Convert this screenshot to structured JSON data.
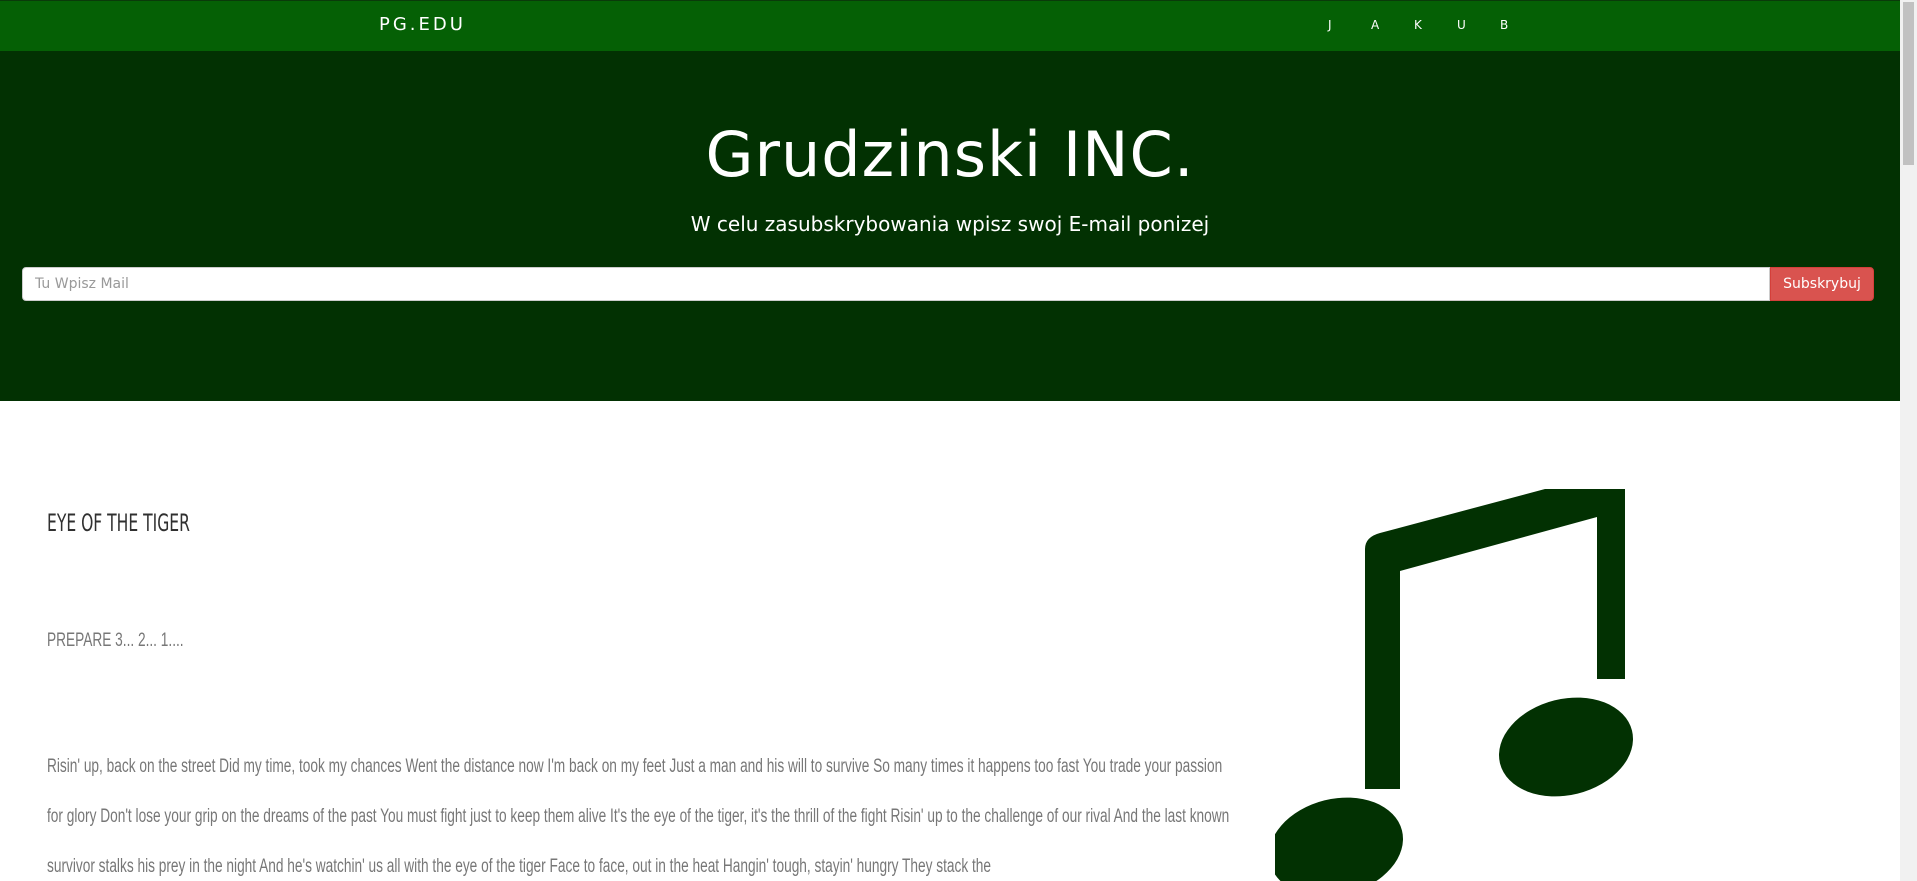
{
  "nav": {
    "brand": "PG.EDU",
    "links": [
      "J",
      "A",
      "K",
      "U",
      "B"
    ]
  },
  "hero": {
    "title": "Grudzinski INC.",
    "subtitle": "W celu zasubskrybowania wpisz swoj E-mail ponizej",
    "email_placeholder": "Tu Wpisz Mail",
    "email_value": "",
    "subscribe_label": "Subskrybuj"
  },
  "content": {
    "song_title": "EYE OF THE TIGER",
    "intro": "PREPARE 3... 2... 1....",
    "lyrics": "Risin' up, back on the street Did my time, took my chances Went the distance now I'm back on my feet Just a man and his will to survive So many times it happens too fast You trade your passion for glory Don't lose your grip on the dreams of the past You must fight just to keep them alive It's the eye of the tiger, it's the thrill of the fight Risin' up to the challenge of our rival And the last known survivor stalks his prey in the night And he's watchin' us all with the eye of the tiger Face to face, out in the heat Hangin' tough, stayin' hungry They stack the"
  },
  "colors": {
    "nav_bg": "#056005",
    "hero_bg": "#023102",
    "button_bg": "#d9534f",
    "icon_color": "#023102"
  },
  "icons": {
    "music": "music-note-icon"
  }
}
